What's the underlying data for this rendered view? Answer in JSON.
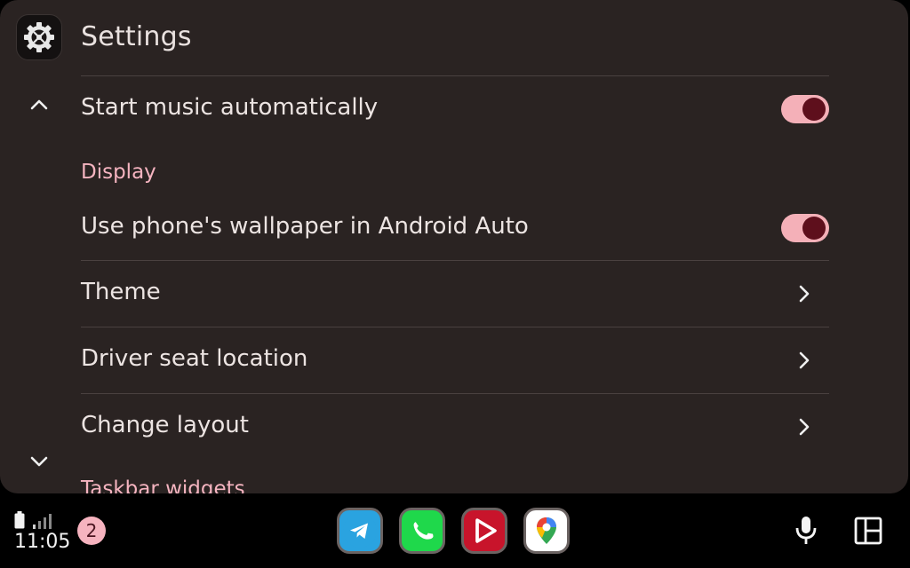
{
  "header": {
    "title": "Settings",
    "icon": "gear-icon"
  },
  "settings": {
    "start_music": {
      "label": "Start music automatically",
      "enabled": true
    },
    "display_header": "Display",
    "wallpaper": {
      "label": "Use phone's wallpaper in Android Auto",
      "enabled": true
    },
    "theme": {
      "label": "Theme"
    },
    "driver_seat": {
      "label": "Driver seat location"
    },
    "change_layout": {
      "label": "Change layout"
    },
    "taskbar_header": "Taskbar widgets"
  },
  "taskbar": {
    "time": "11:05",
    "notification_count": "2",
    "apps": [
      {
        "name": "telegram-app",
        "icon": "telegram-icon",
        "color": "#2aa3e0"
      },
      {
        "name": "phone-app",
        "icon": "phone-icon",
        "color": "#1fd84b"
      },
      {
        "name": "video-app",
        "icon": "play-icon",
        "color": "#c8142b"
      },
      {
        "name": "maps-app",
        "icon": "maps-pin-icon",
        "color": "#ffffff"
      }
    ],
    "mic_icon": "microphone-icon",
    "layout_icon": "layout-grid-icon"
  },
  "colors": {
    "panel_bg": "#2a2322",
    "accent": "#f5b4c0",
    "toggle_track": "#f4b0b8",
    "toggle_knob": "#5e0f1c"
  }
}
